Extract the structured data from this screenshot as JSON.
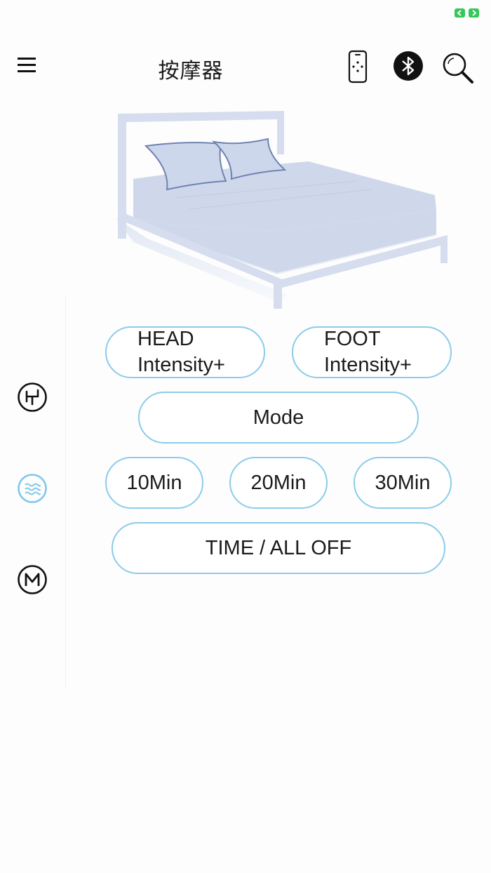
{
  "status": {
    "indicator_color": "#34c759"
  },
  "header": {
    "title": "按摩器",
    "menu_icon": "hamburger-menu-icon",
    "remote_icon": "phone-remote-icon",
    "bluetooth_icon": "bluetooth-icon",
    "search_icon": "search-icon"
  },
  "illustration": {
    "name": "bed-illustration",
    "bed_color": "#d0d9ec",
    "pillow_outline": "#6f82b2"
  },
  "side_rail": {
    "items": [
      {
        "icon": "intensity-mode-icon",
        "active": false
      },
      {
        "icon": "wave-massage-icon",
        "active": true
      },
      {
        "icon": "memory-m-icon",
        "active": false
      }
    ],
    "active_color": "#7fc8ea"
  },
  "controls": {
    "head_intensity": [
      "HEAD",
      "Intensity+"
    ],
    "foot_intensity": [
      "FOOT",
      "Intensity+"
    ],
    "mode": "Mode",
    "timer_10": "10Min",
    "timer_20": "20Min",
    "timer_30": "30Min",
    "all_off": "TIME / ALL OFF",
    "border_color": "#8ccbea"
  }
}
